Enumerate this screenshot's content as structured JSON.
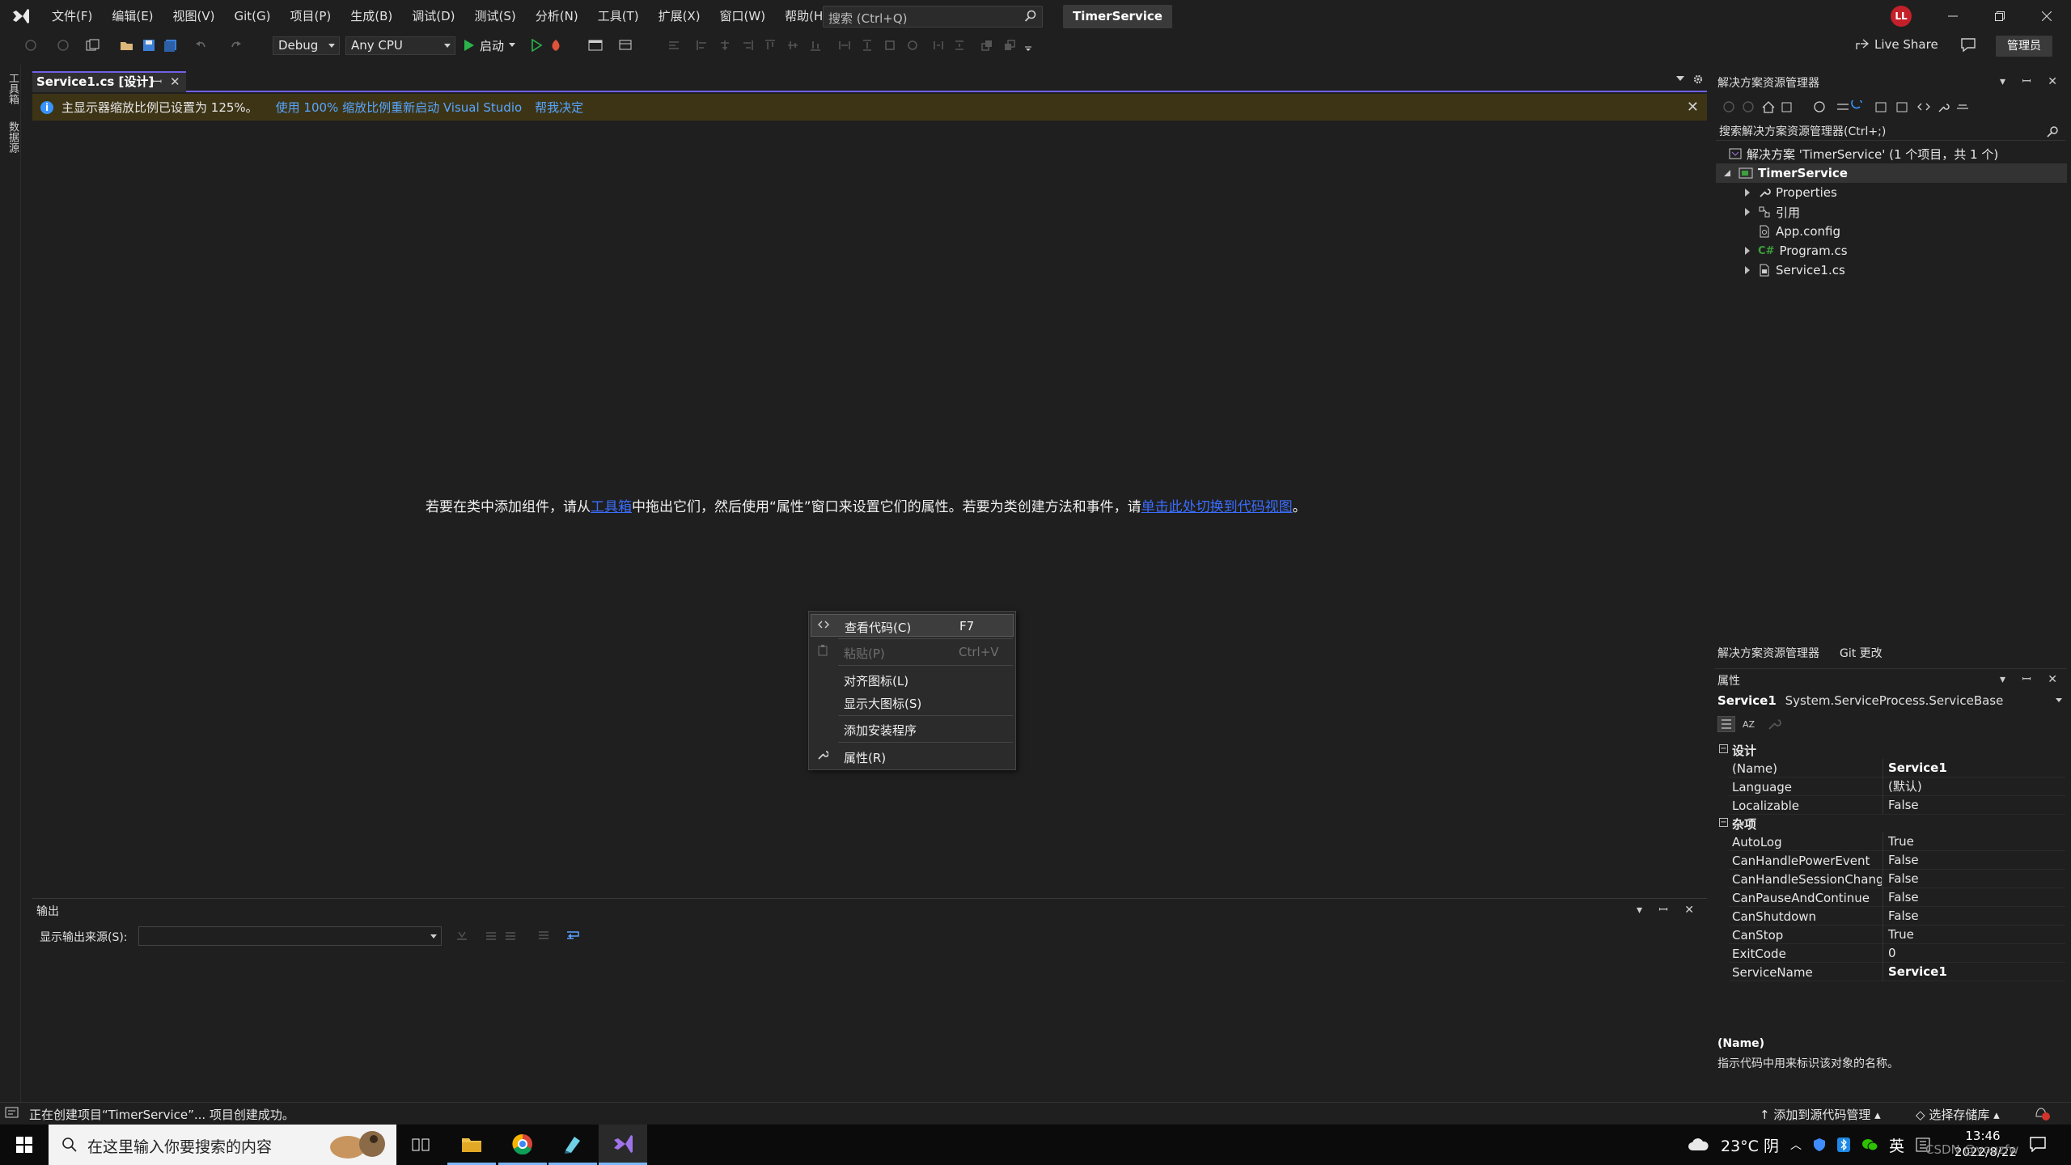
{
  "window": {
    "solution_title": "TimerService",
    "avatar_initials": "LL"
  },
  "menu": [
    "文件(F)",
    "编辑(E)",
    "视图(V)",
    "Git(G)",
    "项目(P)",
    "生成(B)",
    "调试(D)",
    "测试(S)",
    "分析(N)",
    "工具(T)",
    "扩展(X)",
    "窗口(W)",
    "帮助(H)"
  ],
  "search": {
    "placeholder": "搜索 (Ctrl+Q)"
  },
  "toolbar": {
    "config": "Debug",
    "platform": "Any CPU",
    "start_label": "启动",
    "live_share": "Live Share",
    "admin": "管理员"
  },
  "left_strip": {
    "toolbox": "工具箱",
    "datasource": "数据源"
  },
  "document": {
    "tab_label": "Service1.cs [设计]",
    "tab_pin": "ꟷ",
    "tab_close": "✕"
  },
  "infobar": {
    "message": "主显示器缩放比例已设置为 125%。",
    "link1": "使用 100% 缩放比例重新启动 Visual Studio",
    "link2": "帮我决定"
  },
  "designer": {
    "hint_part1": "若要在类中添加组件，请从",
    "hint_link1": "工具箱",
    "hint_part2": "中拖出它们，然后使用“属性”窗口来设置它们的属性。若要为类创建方法和事件，请",
    "hint_link2": "单击此处切换到代码视图",
    "hint_part3": "。"
  },
  "context_menu": {
    "view_code": "查看代码(C)",
    "view_code_shortcut": "F7",
    "paste": "粘贴(P)",
    "paste_shortcut": "Ctrl+V",
    "align_icons": "对齐图标(L)",
    "show_large_icons": "显示大图标(S)",
    "add_installer": "添加安装程序",
    "properties": "属性(R)"
  },
  "output": {
    "title": "输出",
    "source_label": "显示输出来源(S):",
    "source_value": ""
  },
  "solution_explorer": {
    "title": "解决方案资源管理器",
    "search_placeholder": "搜索解决方案资源管理器(Ctrl+;)",
    "solution_label": "解决方案 'TimerService' (1 个项目，共 1 个)",
    "project": "TimerService",
    "items": [
      "Properties",
      "引用",
      "App.config",
      "Program.cs",
      "Service1.cs"
    ],
    "tab1": "解决方案资源管理器",
    "tab2": "Git 更改"
  },
  "properties": {
    "title": "属性",
    "object_name": "Service1",
    "object_type": "System.ServiceProcess.ServiceBase",
    "cat_design": "设计",
    "cat_misc": "杂项",
    "design_rows": [
      {
        "k": "(Name)",
        "v": "Service1"
      },
      {
        "k": "Language",
        "v": "(默认)"
      },
      {
        "k": "Localizable",
        "v": "False"
      }
    ],
    "misc_rows": [
      {
        "k": "AutoLog",
        "v": "True"
      },
      {
        "k": "CanHandlePowerEvent",
        "v": "False"
      },
      {
        "k": "CanHandleSessionChange",
        "v": "False"
      },
      {
        "k": "CanPauseAndContinue",
        "v": "False"
      },
      {
        "k": "CanShutdown",
        "v": "False"
      },
      {
        "k": "CanStop",
        "v": "True"
      },
      {
        "k": "ExitCode",
        "v": "0"
      },
      {
        "k": "ServiceName",
        "v": "Service1"
      }
    ],
    "desc_title": "(Name)",
    "desc_text": "指示代码中用来标识该对象的名称。"
  },
  "status": {
    "message": "正在创建项目“TimerService”... 项目创建成功。",
    "add_source_control": "添加到源代码管理",
    "select_repo": "选择存储库"
  },
  "taskbar": {
    "search_placeholder": "在这里输入你要搜索的内容",
    "weather": "23°C 阴",
    "ime": "英",
    "time": "13:46",
    "date": "2022/8/22",
    "watermark": "CSDN @youzfw"
  },
  "colors": {
    "accent": "#7160e8",
    "infobar": "#3d3416",
    "link": "#57a6ff"
  }
}
